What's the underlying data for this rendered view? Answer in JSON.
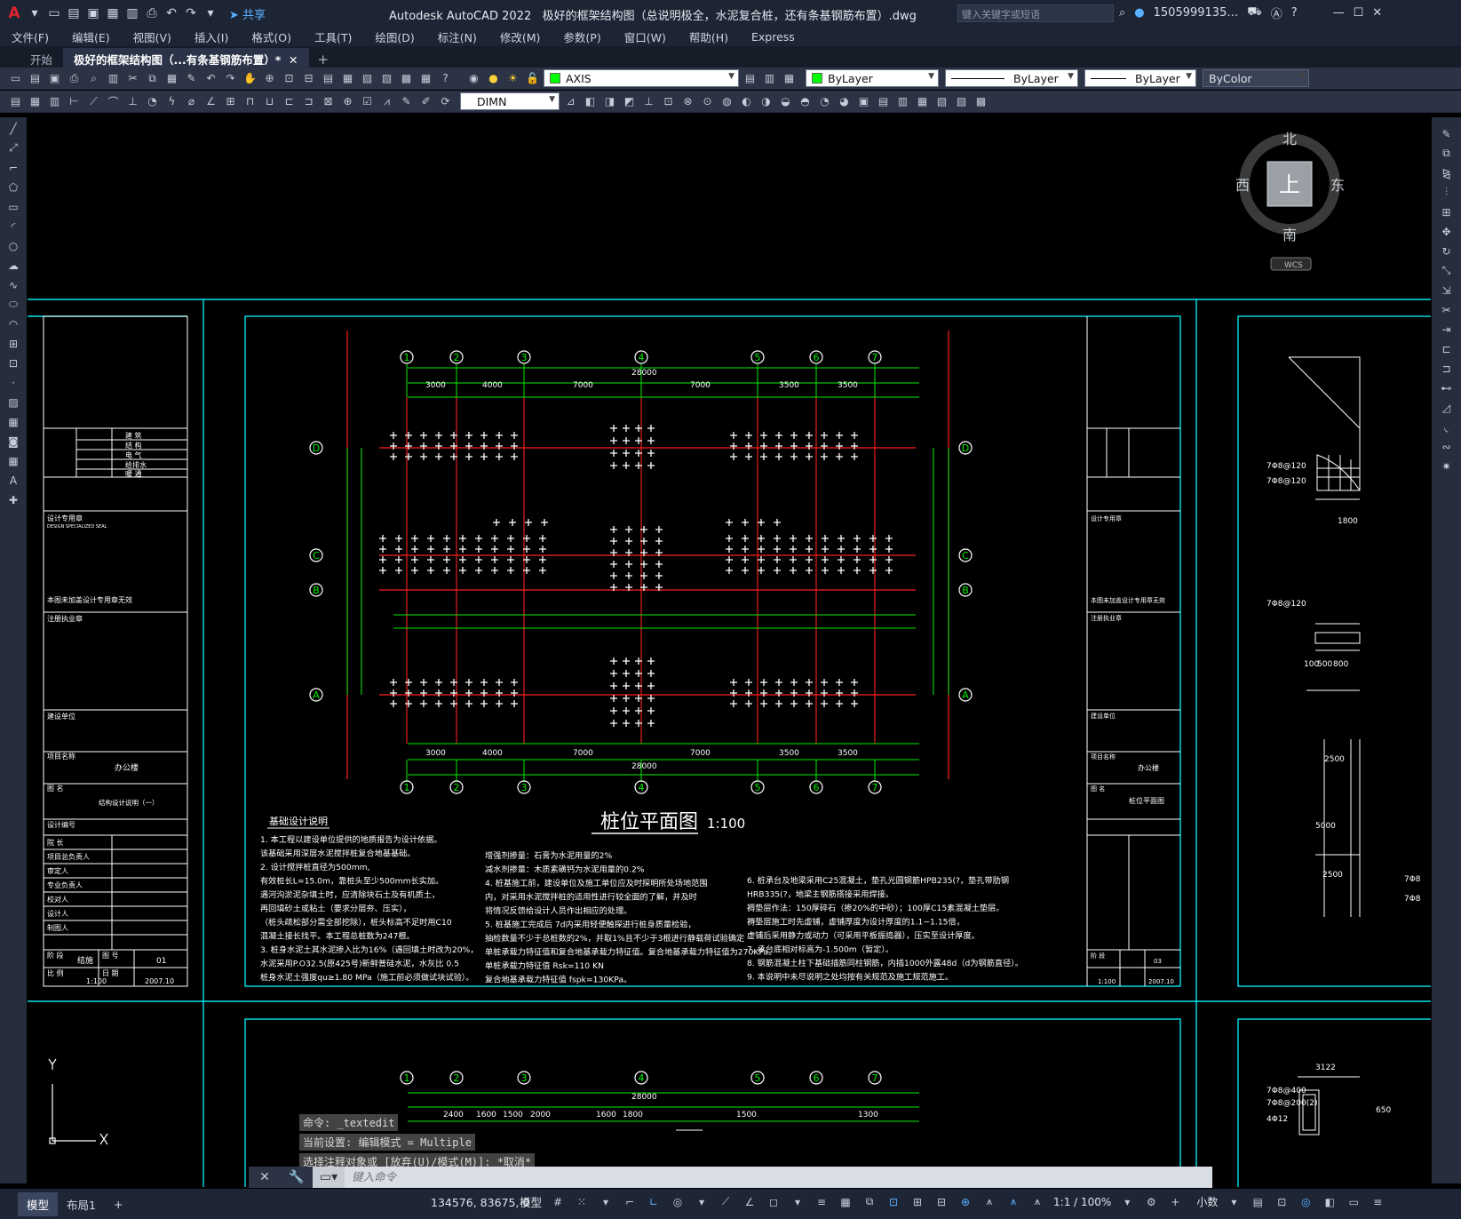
{
  "app": {
    "title": "Autodesk AutoCAD 2022",
    "filename": "极好的框架结构图（总说明极全，水泥复合桩，还有条基钢筋布置）.dwg",
    "share_label": "共享",
    "search_placeholder": "键入关键字或短语",
    "user": "1505999135…"
  },
  "menu": [
    "文件(F)",
    "编辑(E)",
    "视图(V)",
    "插入(I)",
    "格式(O)",
    "工具(T)",
    "绘图(D)",
    "标注(N)",
    "修改(M)",
    "参数(P)",
    "窗口(W)",
    "帮助(H)",
    "Express"
  ],
  "tabs": {
    "start": "开始",
    "active": "极好的框架结构图（...有条基钢筋布置）*"
  },
  "toolbar": {
    "layer": "AXIS",
    "color": "ByLayer",
    "linetype": "ByLayer",
    "lineweight": "ByLayer",
    "plotstyle": "ByColor",
    "dimstyle": "DIMN"
  },
  "viewcube": {
    "north": "北",
    "south": "南",
    "east": "东",
    "west": "西",
    "top": "上",
    "wcs": "WCS"
  },
  "drawing": {
    "axes_num": [
      "1",
      "2",
      "3",
      "4",
      "5",
      "6",
      "7"
    ],
    "axes_letter": [
      "D",
      "C",
      "B",
      "A"
    ],
    "total_dim": "28000",
    "top_dims": [
      "3000",
      "4000",
      "7000",
      "7000",
      "3500",
      "3500"
    ],
    "title": "桩位平面图",
    "scale": "1:100",
    "notes_title": "基础设计说明",
    "notes_col1": [
      "1. 本工程以建设单位提供的地质报告为设计依据。",
      "   该基础采用深层水泥搅拌桩复合地基基础。",
      "2. 设计搅拌桩直径为500mm,",
      "   有效桩长L=15.0m，靠桩头至少500mm长实加。",
      "   遇河沟淤泥杂填土时，应清除块石土及有机质土，",
      "   再回填砂土或粘土（要求分层夯、压实），",
      "   （桩头疏松部分需全部挖除），桩头标高不足时用C10",
      "   混凝土接长找平。本工程总桩数为247根。",
      "3. 桩身水泥土其水泥掺入比为16%（遇回填土时改为20%，",
      "   水泥采用P.O32.5(原425号)新鲜普硅水泥，水灰比 0.5",
      "   桩身水泥土强度qu≥1.80 MPa（施工前必须做试块试验）。"
    ],
    "notes_col2": [
      "增强剂掺量：石膏为水泥用量的2%",
      "减水剂掺量：木质素磺钙为水泥用量的0.2%",
      "4. 桩基施工前，建设单位及施工单位应及时探明所处场地范围",
      "   内，对采用水泥搅拌桩的适用性进行较全面的了解，并及时",
      "   将情况反馈给设计人员作出相应的处理。",
      "5. 桩基施工完成后 7d内采用轻便触探进行桩身质量检验，",
      "   抽检数量不少于总桩数的2%，并取1%且不少于3根进行静载荷试验确定",
      "   单桩承载力特征值和复合地基承载力特征值。复合地基承载力特征值为270KPa。",
      "   单桩承载力特征值        Rsk=110 KN",
      "   复合地基承载力特征值    fspk=130KPa。"
    ],
    "notes_col3": [
      "6. 桩承台及地梁采用C25混凝土，垫孔光圆钢筋HPB235(?，垫孔带肋钢",
      "   HRB335(?，地梁主钢筋搭接采用焊接。",
      "   褥垫层作法：150厚碎石（掺20%的中砂）；100厚C15素混凝土垫层。",
      "   褥垫层施工时先虚铺，虚铺厚度为设计厚度的1.1~1.15倍，",
      "   虚铺后采用静力或动力（可采用平板振捣器），压实至设计厚度。",
      "7. 承台底相对标高为-1.500m（暂定）。",
      "8. 钢筋混凝土柱下基础插筋同柱钢筋，内插1000外露48d（d为钢筋直径）。",
      "9. 本说明中未尽说明之处均按有关规范及施工规范施工。"
    ],
    "left_block": {
      "disciplines": [
        "建 筑",
        "结 构",
        "电 气",
        "给排水",
        "暖 通"
      ],
      "seal": "设计专用章",
      "seal_en": "DESIGN SPECIALIZED SEAL",
      "valid": "本图未加盖设计专用章无效",
      "reg": "注册执业章",
      "owner": "建设单位",
      "project_label": "项目名称",
      "project": "办公楼",
      "drawing_label": "图 名",
      "drawing_name": "结构设计说明（一）",
      "drawing_no_label": "设计编号",
      "roles": [
        "院 长",
        "项目总负责人",
        "审定人",
        "专业负责人",
        "校对人",
        "设计人",
        "制图人"
      ],
      "stage_label": "阶 段",
      "stage": "结施",
      "no_label": "图 号",
      "no": "01",
      "scale_label": "比 例",
      "scale": "1:100",
      "date_label": "日 期",
      "date": "2007.10"
    },
    "right_block": {
      "drawing_name": "桩位平面图",
      "no": "03"
    },
    "right_partial": {
      "labels": [
        "7Φ8@120",
        "7Φ8@120",
        "1800",
        "7Φ8@120",
        "100",
        "500",
        "800",
        "5000",
        "2500",
        "2500",
        "7Φ8",
        "7Φ8"
      ]
    },
    "lower_dims": [
      "2400",
      "1600",
      "1500",
      "2000",
      "1600",
      "1800",
      "1500",
      "1300",
      "3122",
      "7Φ8@400",
      "7Φ8@200(2)",
      "4Φ12",
      "650"
    ]
  },
  "command": {
    "history": [
      "命令:  _textedit",
      "当前设置: 编辑模式 = Multiple",
      "选择注释对象或 [放弃(U)/模式(M)]: *取消*"
    ],
    "placeholder": "键入命令"
  },
  "status": {
    "layouts": [
      "模型",
      "布局1"
    ],
    "coords": "134576, 83675, 0",
    "model": "模型",
    "annoscale": "1:1 / 100%",
    "units": "小数"
  }
}
